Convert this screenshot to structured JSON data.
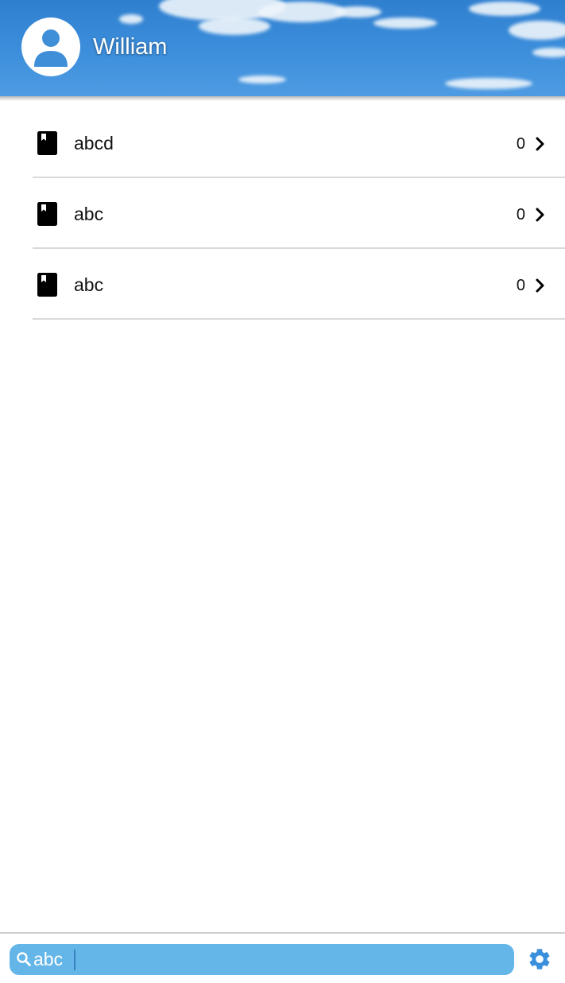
{
  "header": {
    "username": "William",
    "avatar_icon": "person-icon",
    "sky_color": "#3d8fdc"
  },
  "list": {
    "items": [
      {
        "label": "abcd",
        "count": "0",
        "icon": "book-icon"
      },
      {
        "label": "abc",
        "count": "0",
        "icon": "book-icon"
      },
      {
        "label": "abc",
        "count": "0",
        "icon": "book-icon"
      }
    ]
  },
  "search": {
    "value": "abc",
    "placeholder": "",
    "icon": "search-icon",
    "bar_color": "#64b6e8"
  },
  "settings": {
    "icon": "gear-icon",
    "color": "#3a8fdc"
  }
}
